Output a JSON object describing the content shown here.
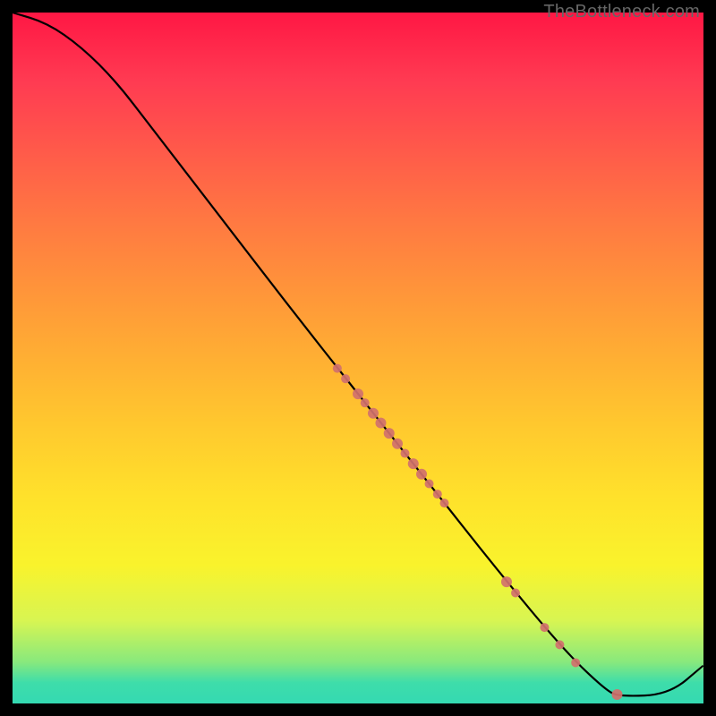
{
  "watermark": "TheBottleneck.com",
  "chart_data": {
    "type": "line",
    "title": "",
    "xlabel": "",
    "ylabel": "",
    "xlim": [
      0,
      100
    ],
    "ylim": [
      0,
      100
    ],
    "curve": [
      {
        "x": 0,
        "y": 100
      },
      {
        "x": 5,
        "y": 98.5
      },
      {
        "x": 10,
        "y": 95
      },
      {
        "x": 15,
        "y": 90
      },
      {
        "x": 20,
        "y": 83.5
      },
      {
        "x": 30,
        "y": 70.5
      },
      {
        "x": 40,
        "y": 57.5
      },
      {
        "x": 50,
        "y": 44.8
      },
      {
        "x": 60,
        "y": 32.2
      },
      {
        "x": 70,
        "y": 19.5
      },
      {
        "x": 80,
        "y": 7.5
      },
      {
        "x": 86,
        "y": 1.8
      },
      {
        "x": 88,
        "y": 1.0
      },
      {
        "x": 95,
        "y": 1.3
      },
      {
        "x": 100,
        "y": 5.5
      }
    ],
    "scatter_points": [
      {
        "x": 47.0,
        "y": 48.5,
        "r": 5
      },
      {
        "x": 48.2,
        "y": 47.0,
        "r": 5
      },
      {
        "x": 50.0,
        "y": 44.8,
        "r": 6
      },
      {
        "x": 51.0,
        "y": 43.5,
        "r": 5
      },
      {
        "x": 52.2,
        "y": 42.0,
        "r": 6
      },
      {
        "x": 53.3,
        "y": 40.6,
        "r": 6
      },
      {
        "x": 54.5,
        "y": 39.1,
        "r": 6
      },
      {
        "x": 55.7,
        "y": 37.6,
        "r": 6
      },
      {
        "x": 56.8,
        "y": 36.2,
        "r": 5
      },
      {
        "x": 58.0,
        "y": 34.7,
        "r": 6
      },
      {
        "x": 59.2,
        "y": 33.2,
        "r": 6
      },
      {
        "x": 60.3,
        "y": 31.8,
        "r": 5
      },
      {
        "x": 61.5,
        "y": 30.3,
        "r": 5
      },
      {
        "x": 62.5,
        "y": 29.0,
        "r": 5
      },
      {
        "x": 71.5,
        "y": 17.6,
        "r": 6
      },
      {
        "x": 72.8,
        "y": 16.0,
        "r": 5
      },
      {
        "x": 77.0,
        "y": 11.0,
        "r": 5
      },
      {
        "x": 79.2,
        "y": 8.5,
        "r": 5
      },
      {
        "x": 81.5,
        "y": 5.9,
        "r": 5
      },
      {
        "x": 87.5,
        "y": 1.3,
        "r": 6
      }
    ],
    "colors": {
      "curve": "#000000",
      "points": "#d1716c"
    }
  }
}
